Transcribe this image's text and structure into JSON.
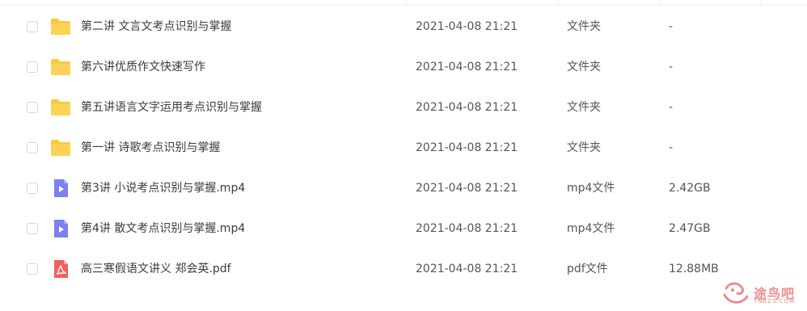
{
  "files": [
    {
      "name": "第二讲 文言文考点识别与掌握",
      "date": "2021-04-08 21:21",
      "type": "文件夹",
      "size": "-",
      "icon": "folder-icon"
    },
    {
      "name": "第六讲优质作文快速写作",
      "date": "2021-04-08 21:21",
      "type": "文件夹",
      "size": "-",
      "icon": "folder-icon"
    },
    {
      "name": "第五讲语言文字运用考点识别与掌握",
      "date": "2021-04-08 21:21",
      "type": "文件夹",
      "size": "-",
      "icon": "folder-icon"
    },
    {
      "name": "第一讲  诗歌考点识别与掌握",
      "date": "2021-04-08 21:21",
      "type": "文件夹",
      "size": "-",
      "icon": "folder-icon"
    },
    {
      "name": "第3讲 小说考点识别与掌握.mp4",
      "date": "2021-04-08 21:21",
      "type": "mp4文件",
      "size": "2.42GB",
      "icon": "video-file-icon"
    },
    {
      "name": "第4讲 散文考点识别与掌握.mp4",
      "date": "2021-04-08 21:21",
      "type": "mp4文件",
      "size": "2.47GB",
      "icon": "video-file-icon"
    },
    {
      "name": "高三寒假语文讲义 郑会英.pdf",
      "date": "2021-04-08 21:21",
      "type": "pdf文件",
      "size": "12.88MB",
      "icon": "pdf-file-icon"
    }
  ],
  "watermark": {
    "text": "途鸟吧",
    "sub": "TNBZS.COM"
  },
  "colors": {
    "folder": "#fcc83e",
    "video": "#7b80f2",
    "pdf": "#f25f5f",
    "watermark": "#f08a8a"
  }
}
